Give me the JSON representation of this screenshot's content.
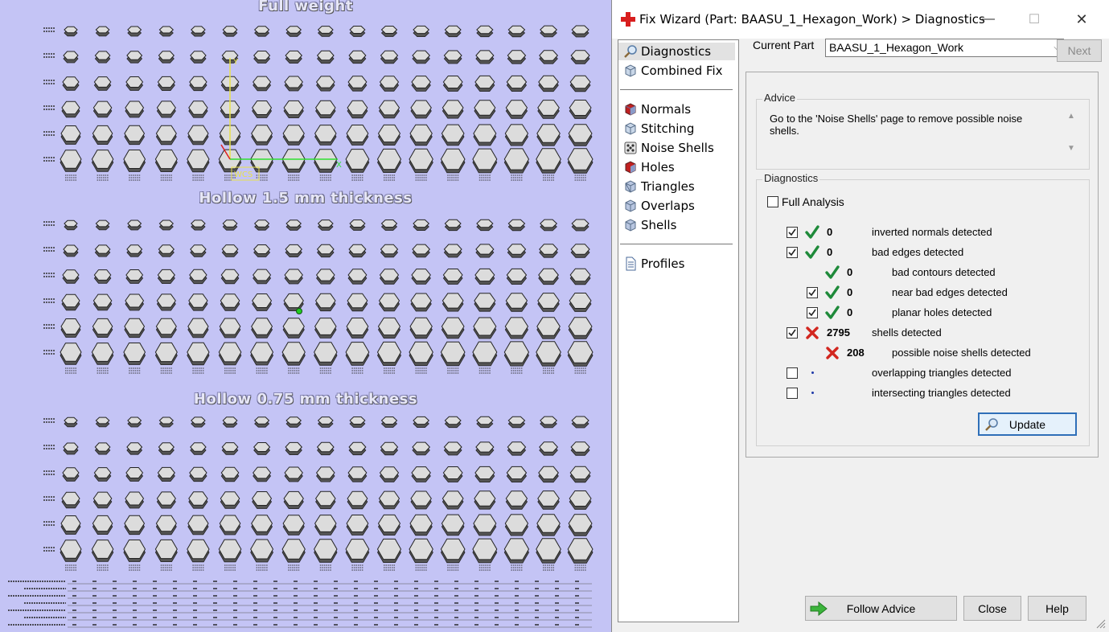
{
  "viewport": {
    "section_titles": [
      "Full weight",
      "Hollow 1.5 mm thickness",
      "Hollow 0.75 mm thickness"
    ],
    "axis_label": "WCS"
  },
  "dialog": {
    "title": "Fix Wizard (Part: BAASU_1_Hexagon_Work) > Diagnostics",
    "window_controls": {
      "minimize": "—",
      "maximize": "☐",
      "close": "✕"
    },
    "nav": {
      "top": [
        {
          "label": "Diagnostics",
          "icon": "magnifier-icon",
          "selected": true
        },
        {
          "label": "Combined Fix",
          "icon": "cube-icon"
        }
      ],
      "middle": [
        {
          "label": "Normals",
          "icon": "normals-icon"
        },
        {
          "label": "Stitching",
          "icon": "stitching-icon"
        },
        {
          "label": "Noise Shells",
          "icon": "noise-shells-icon"
        },
        {
          "label": "Holes",
          "icon": "holes-icon"
        },
        {
          "label": "Triangles",
          "icon": "triangles-icon"
        },
        {
          "label": "Overlaps",
          "icon": "overlaps-icon"
        },
        {
          "label": "Shells",
          "icon": "shells-icon"
        }
      ],
      "bottom": [
        {
          "label": "Profiles",
          "icon": "document-icon"
        }
      ]
    },
    "current_part_label": "Current Part",
    "current_part_value": "BAASU_1_Hexagon_Work",
    "next_label": "Next",
    "advice": {
      "title": "Advice",
      "text": "Go to the 'Noise Shells' page to remove possible noise shells."
    },
    "diagnostics": {
      "title": "Diagnostics",
      "full_analysis_label": "Full Analysis",
      "full_analysis_checked": false,
      "rows": [
        {
          "checkbox": true,
          "checked": true,
          "status": "ok",
          "count": "0",
          "label": "inverted normals detected",
          "indent": 0
        },
        {
          "checkbox": true,
          "checked": true,
          "status": "ok",
          "count": "0",
          "label": "bad edges detected",
          "indent": 0
        },
        {
          "checkbox": false,
          "checked": false,
          "status": "ok",
          "count": "0",
          "label": "bad contours detected",
          "indent": 1
        },
        {
          "checkbox": true,
          "checked": true,
          "status": "ok",
          "count": "0",
          "label": "near bad edges detected",
          "indent": 1
        },
        {
          "checkbox": true,
          "checked": true,
          "status": "ok",
          "count": "0",
          "label": "planar holes detected",
          "indent": 1
        },
        {
          "checkbox": true,
          "checked": true,
          "status": "fail",
          "count": "2795",
          "label": "shells detected",
          "indent": 0
        },
        {
          "checkbox": false,
          "checked": false,
          "status": "fail",
          "count": "208",
          "label": "possible noise shells detected",
          "indent": 1
        },
        {
          "checkbox": true,
          "checked": false,
          "status": "none",
          "count": "",
          "label": "overlapping triangles detected",
          "indent": 0
        },
        {
          "checkbox": true,
          "checked": false,
          "status": "none",
          "count": "",
          "label": "intersecting triangles detected",
          "indent": 0
        }
      ]
    },
    "update_label": "Update",
    "follow_advice_label": "Follow Advice",
    "close_label": "Close",
    "help_label": "Help",
    "colors": {
      "ok": "#1e8a3a",
      "fail": "#d2261f",
      "accent": "#2f6fb8"
    }
  }
}
